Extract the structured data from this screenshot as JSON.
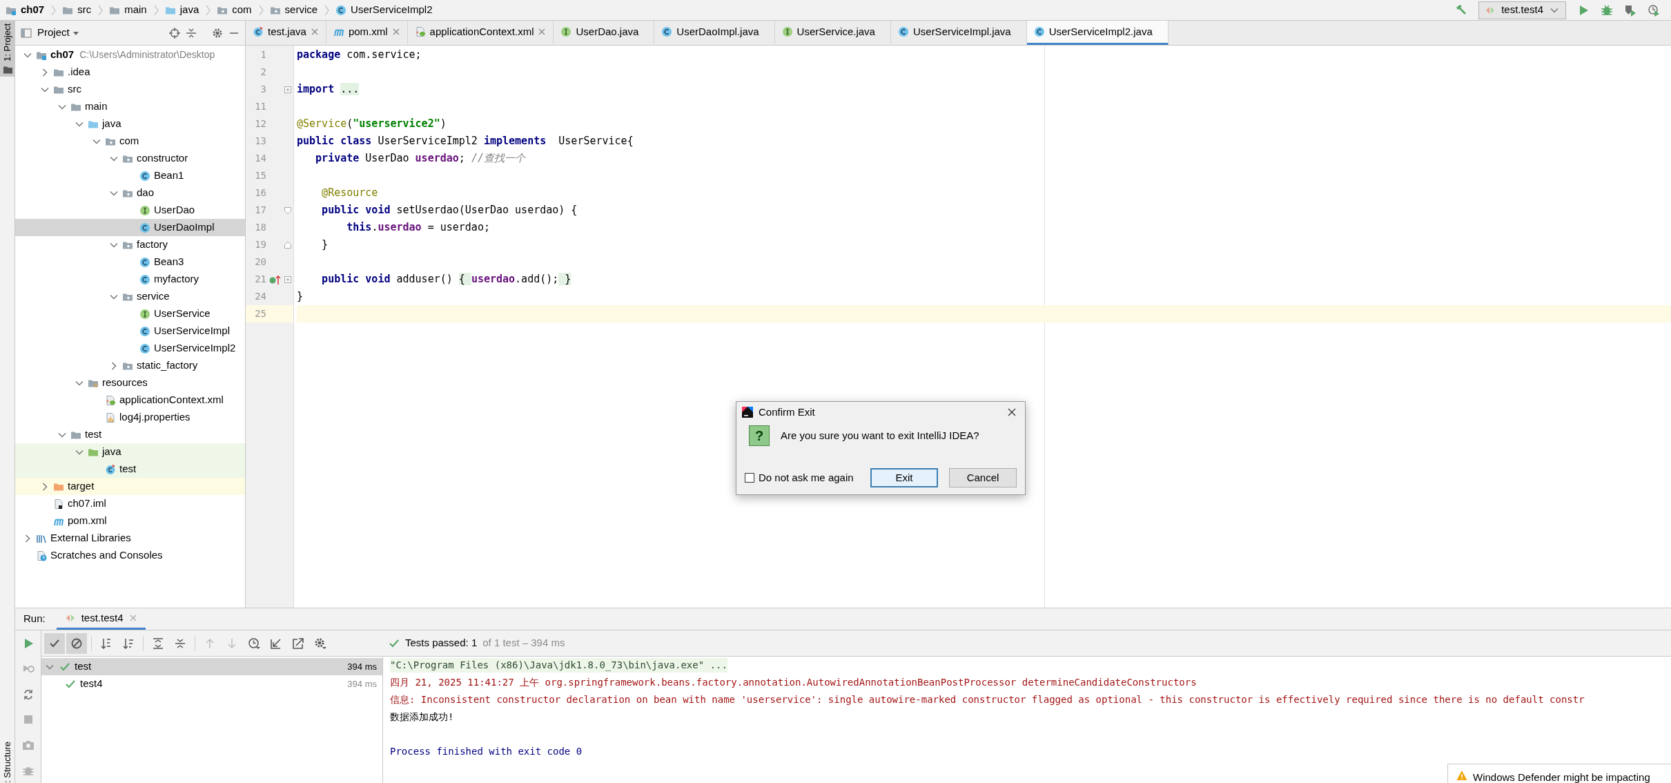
{
  "breadcrumbs": [
    {
      "kind": "module",
      "label": "ch07"
    },
    {
      "kind": "folder",
      "label": "src"
    },
    {
      "kind": "folder",
      "label": "main"
    },
    {
      "kind": "source-folder",
      "label": "java"
    },
    {
      "kind": "package",
      "label": "com"
    },
    {
      "kind": "package",
      "label": "service"
    },
    {
      "kind": "class",
      "label": "UserServiceImpl2"
    }
  ],
  "run_config": {
    "label": "test.test4"
  },
  "side_strip": {
    "top_label": "1: Project",
    "bottom_label": ": Structure"
  },
  "project_panel": {
    "title": "Project",
    "tree": [
      {
        "label": "ch07",
        "path": "C:\\Users\\Administrator\\Desktop",
        "kind": "module",
        "expanded": true,
        "selected": false,
        "children": [
          {
            "label": ".idea",
            "kind": "folder",
            "expanded": false,
            "selected": false
          },
          {
            "label": "src",
            "kind": "folder",
            "expanded": true,
            "selected": false,
            "children": [
              {
                "label": "main",
                "kind": "folder",
                "expanded": true,
                "selected": false,
                "children": [
                  {
                    "label": "java",
                    "kind": "source-folder",
                    "expanded": true,
                    "selected": false,
                    "children": [
                      {
                        "label": "com",
                        "kind": "package",
                        "expanded": true,
                        "selected": false,
                        "children": [
                          {
                            "label": "constructor",
                            "kind": "package",
                            "expanded": true,
                            "selected": false,
                            "children": [
                              {
                                "label": "Bean1",
                                "kind": "class",
                                "selected": false
                              }
                            ]
                          },
                          {
                            "label": "dao",
                            "kind": "package",
                            "expanded": true,
                            "selected": false,
                            "children": [
                              {
                                "label": "UserDao",
                                "kind": "interface",
                                "selected": false
                              },
                              {
                                "label": "UserDaoImpl",
                                "kind": "class",
                                "selected": true
                              }
                            ]
                          },
                          {
                            "label": "factory",
                            "kind": "package",
                            "expanded": true,
                            "selected": false,
                            "children": [
                              {
                                "label": "Bean3",
                                "kind": "class",
                                "selected": false
                              },
                              {
                                "label": "myfactory",
                                "kind": "class",
                                "selected": false
                              }
                            ]
                          },
                          {
                            "label": "service",
                            "kind": "package",
                            "expanded": true,
                            "selected": false,
                            "children": [
                              {
                                "label": "UserService",
                                "kind": "interface",
                                "selected": false
                              },
                              {
                                "label": "UserServiceImpl",
                                "kind": "class",
                                "selected": false
                              },
                              {
                                "label": "UserServiceImpl2",
                                "kind": "class",
                                "selected": false
                              }
                            ]
                          },
                          {
                            "label": "static_factory",
                            "kind": "package",
                            "expanded": false,
                            "selected": false
                          }
                        ]
                      }
                    ]
                  },
                  {
                    "label": "resources",
                    "kind": "resources-folder",
                    "expanded": true,
                    "selected": false,
                    "children": [
                      {
                        "label": "applicationContext.xml",
                        "kind": "spring-xml",
                        "selected": false
                      },
                      {
                        "label": "log4j.properties",
                        "kind": "properties",
                        "selected": false
                      }
                    ]
                  }
                ]
              },
              {
                "label": "test",
                "kind": "folder",
                "expanded": true,
                "selected": false,
                "children": [
                  {
                    "label": "java",
                    "kind": "test-folder",
                    "expanded": true,
                    "selected": false,
                    "children": [
                      {
                        "label": "test",
                        "kind": "test-class",
                        "selected": false
                      }
                    ]
                  }
                ]
              }
            ]
          },
          {
            "label": "target",
            "kind": "excluded-folder",
            "expanded": false,
            "selected": false
          },
          {
            "label": "ch07.iml",
            "kind": "iml",
            "selected": false
          },
          {
            "label": "pom.xml",
            "kind": "maven",
            "selected": false
          }
        ]
      },
      {
        "label": "External Libraries",
        "kind": "libraries",
        "expanded": false,
        "selected": false
      },
      {
        "label": "Scratches and Consoles",
        "kind": "scratches",
        "selected": false
      }
    ]
  },
  "editor_tabs": [
    {
      "label": "test.java",
      "kind": "test-class",
      "close_button": true,
      "selected": false
    },
    {
      "label": "pom.xml",
      "kind": "maven",
      "close_button": true,
      "selected": false
    },
    {
      "label": "applicationContext.xml",
      "kind": "spring-xml",
      "close_button": true,
      "selected": false
    },
    {
      "label": "UserDao.java",
      "kind": "interface",
      "close_button": false,
      "selected": false
    },
    {
      "label": "UserDaoImpl.java",
      "kind": "class",
      "close_button": false,
      "selected": false
    },
    {
      "label": "UserService.java",
      "kind": "interface",
      "close_button": false,
      "selected": false
    },
    {
      "label": "UserServiceImpl.java",
      "kind": "class",
      "close_button": false,
      "selected": false
    },
    {
      "label": "UserServiceImpl2.java",
      "kind": "class",
      "close_button": false,
      "selected": true
    }
  ],
  "code_lines": [
    {
      "number": "1",
      "current": false,
      "tokens": [
        {
          "kind": "keyword",
          "text": "package"
        },
        {
          "kind": "plain",
          "text": " com.service;"
        }
      ]
    },
    {
      "number": "2",
      "current": false
    },
    {
      "number": "3",
      "current": false,
      "gutter_icons": [
        {
          "kind": "fold-expand"
        }
      ],
      "tokens": [
        {
          "kind": "keyword",
          "text": "import "
        },
        {
          "kind": "folded",
          "text": "..."
        }
      ]
    },
    {
      "number": "11",
      "current": false
    },
    {
      "number": "12",
      "current": false,
      "tokens": [
        {
          "kind": "annotation",
          "text": "@Service"
        },
        {
          "kind": "plain",
          "text": "("
        },
        {
          "kind": "string",
          "text": "\"userservice2\""
        },
        {
          "kind": "plain",
          "text": ")"
        }
      ]
    },
    {
      "number": "13",
      "current": false,
      "tokens": [
        {
          "kind": "keyword",
          "text": "public class"
        },
        {
          "kind": "plain",
          "text": " UserServiceImpl2 "
        },
        {
          "kind": "keyword",
          "text": "implements"
        },
        {
          "kind": "plain",
          "text": "  UserService{"
        }
      ]
    },
    {
      "number": "14",
      "current": false,
      "tokens": [
        {
          "kind": "keyword",
          "text": "   private"
        },
        {
          "kind": "plain",
          "text": " UserDao "
        },
        {
          "kind": "field",
          "text": "userdao"
        },
        {
          "kind": "plain",
          "text": "; "
        },
        {
          "kind": "comment",
          "text": "//查找一个"
        }
      ]
    },
    {
      "number": "15",
      "current": false
    },
    {
      "number": "16",
      "current": false,
      "tokens": [
        {
          "kind": "annotation",
          "text": "    @Resource"
        }
      ]
    },
    {
      "number": "17",
      "current": false,
      "gutter_icons": [
        {
          "kind": "fold-collapse"
        }
      ],
      "tokens": [
        {
          "kind": "keyword",
          "text": "    public void"
        },
        {
          "kind": "plain",
          "text": " setUserdao(UserDao userdao) {"
        }
      ]
    },
    {
      "number": "18",
      "current": false,
      "tokens": [
        {
          "kind": "keyword",
          "text": "        this"
        },
        {
          "kind": "plain",
          "text": "."
        },
        {
          "kind": "field",
          "text": "userdao"
        },
        {
          "kind": "plain",
          "text": " = userdao;"
        }
      ]
    },
    {
      "number": "19",
      "current": false,
      "gutter_icons": [
        {
          "kind": "fold-end"
        }
      ],
      "tokens": [
        {
          "kind": "plain",
          "text": "    }"
        }
      ]
    },
    {
      "number": "20",
      "current": false
    },
    {
      "number": "21",
      "current": false,
      "gutter_icons": [
        {
          "kind": "implements"
        },
        {
          "kind": "fold-expand"
        }
      ],
      "tokens": [
        {
          "kind": "keyword",
          "text": "    public void"
        },
        {
          "kind": "plain",
          "text": " adduser() "
        },
        {
          "kind": "folded",
          "text": "{ "
        },
        {
          "kind": "field",
          "text": "userdao"
        },
        {
          "kind": "plain",
          "text": ".add();"
        },
        {
          "kind": "folded",
          "text": " }"
        }
      ]
    },
    {
      "number": "24",
      "current": false,
      "tokens": [
        {
          "kind": "plain",
          "text": "}"
        }
      ]
    },
    {
      "number": "25",
      "current": true
    }
  ],
  "dialog": {
    "title": "Confirm Exit",
    "icon_text": "?",
    "message": "Are you sure you want to exit IntelliJ IDEA?",
    "checkbox": {
      "label": "Do not ask me again",
      "checked": false
    },
    "buttons": [
      {
        "label": "Exit",
        "default": true
      },
      {
        "label": "Cancel",
        "default": false
      }
    ]
  },
  "run_panel": {
    "label": "Run:",
    "tab": {
      "label": "test.test4"
    },
    "side_toolbar": [
      {
        "kind": "run",
        "disabled": false
      },
      {
        "kind": "rerun-failed",
        "disabled": true
      },
      {
        "kind": "toggle-auto",
        "disabled": false
      },
      {
        "kind": "stop",
        "disabled": true
      },
      {
        "kind": "camera",
        "disabled": true
      },
      {
        "kind": "debug",
        "disabled": true
      }
    ],
    "toolbar": [
      {
        "kind": "show-passed",
        "pressed": true,
        "disabled": false
      },
      {
        "kind": "show-ignored",
        "pressed": true,
        "disabled": false
      },
      {
        "kind": "sort-alpha",
        "pressed": false,
        "disabled": false
      },
      {
        "kind": "sort-duration",
        "pressed": false,
        "disabled": false
      },
      {
        "kind": "expand-all",
        "pressed": false,
        "disabled": false
      },
      {
        "kind": "collapse-all",
        "pressed": false,
        "disabled": false
      },
      {
        "kind": "previous",
        "pressed": false,
        "disabled": true
      },
      {
        "kind": "next",
        "pressed": false,
        "disabled": true
      },
      {
        "kind": "history",
        "pressed": false,
        "disabled": false
      },
      {
        "kind": "import",
        "pressed": false,
        "disabled": false
      },
      {
        "kind": "export",
        "pressed": false,
        "disabled": false
      },
      {
        "kind": "settings",
        "pressed": false,
        "disabled": false
      }
    ],
    "status": {
      "label": "Tests passed: 1",
      "detail": "of 1 test – 394 ms"
    },
    "tests": [
      {
        "name": "test",
        "time": "394 ms",
        "expanded": true,
        "selected": true,
        "children": [
          {
            "name": "test4",
            "time": "394 ms",
            "selected": false
          }
        ]
      }
    ],
    "console": [
      {
        "kind": "command",
        "text": "\"C:\\Program Files (x86)\\Java\\jdk1.8.0_73\\bin\\java.exe\" ..."
      },
      {
        "kind": "error",
        "text": "四月 21, 2025 11:41:27 上午 org.springframework.beans.factory.annotation.AutowiredAnnotationBeanPostProcessor determineCandidateConstructors"
      },
      {
        "kind": "error",
        "text": "信息: Inconsistent constructor declaration on bean with name 'userservice': single autowire-marked constructor flagged as optional - this constructor is effectively required since there is no default constr"
      },
      {
        "kind": "output",
        "text": "数据添加成功!"
      },
      {
        "kind": "blank"
      },
      {
        "kind": "info",
        "text": "Process finished with exit code 0"
      }
    ]
  },
  "notification": {
    "text": "Windows Defender might be impacting"
  }
}
